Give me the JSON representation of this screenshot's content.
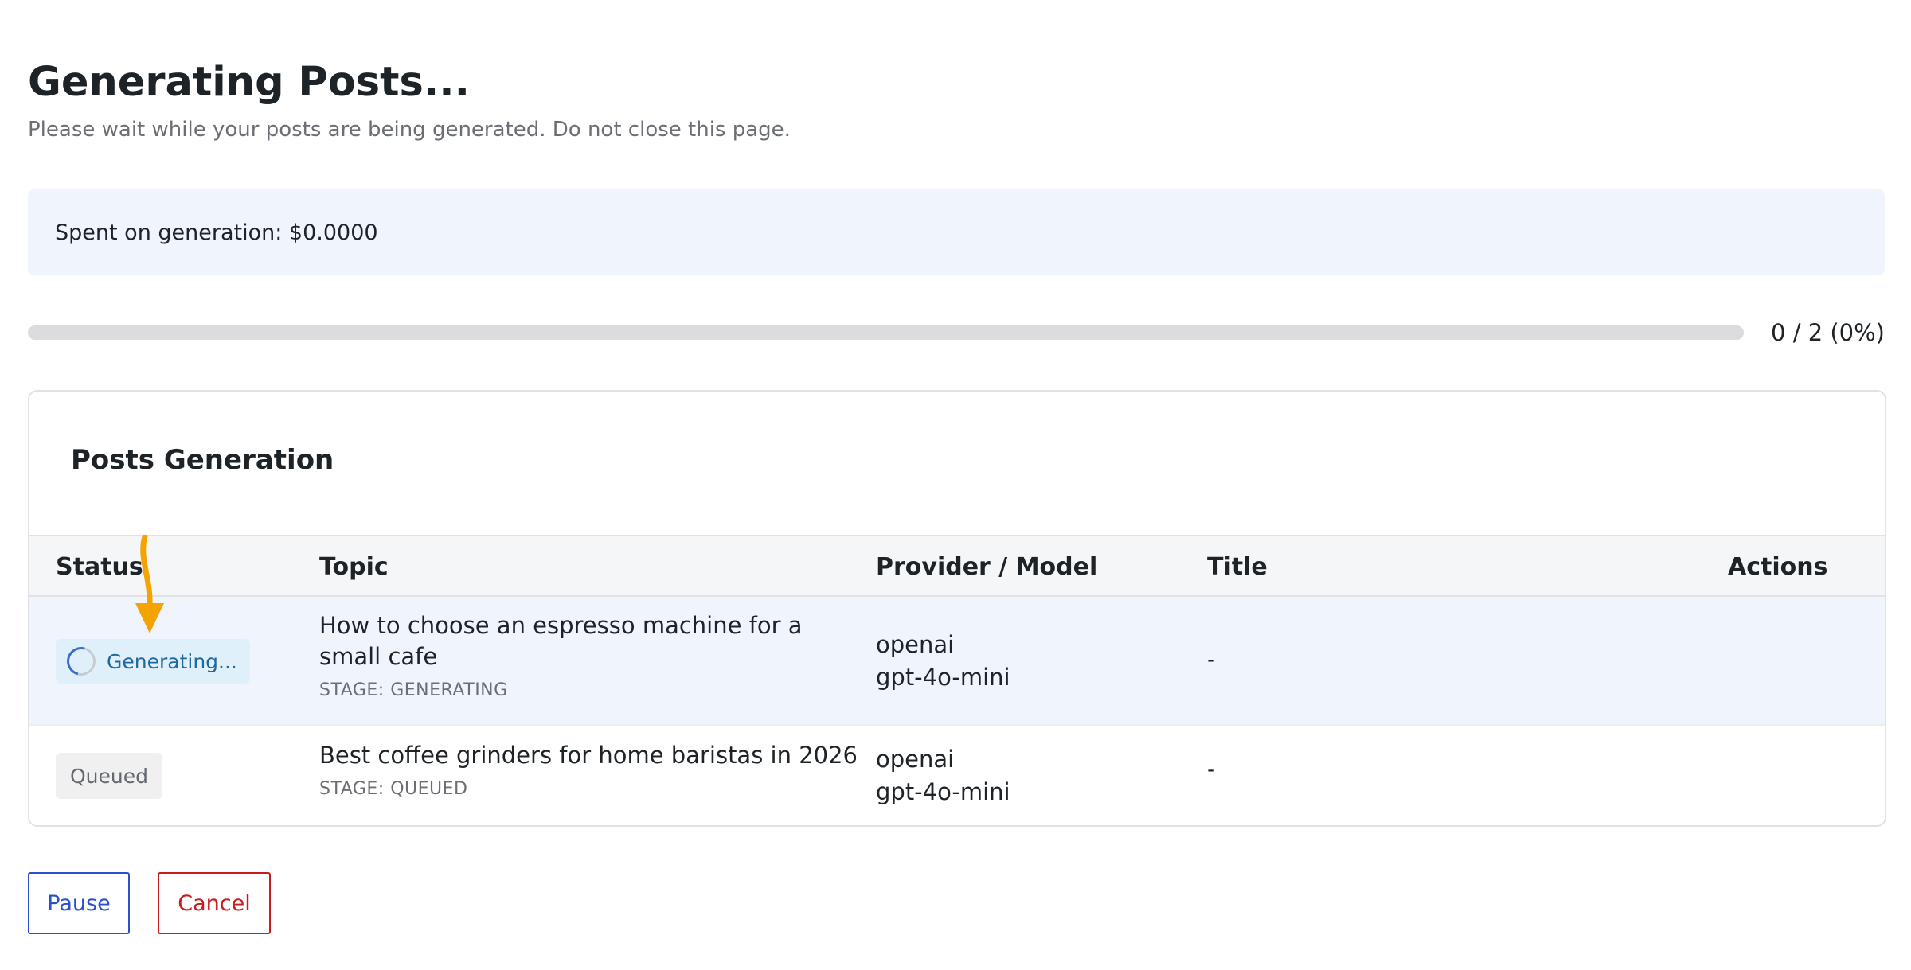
{
  "header": {
    "title": "Generating Posts...",
    "subtitle": "Please wait while your posts are being generated. Do not close this page."
  },
  "cost": {
    "text": "Spent on generation: $0.0000"
  },
  "progress": {
    "done": 0,
    "total": 2,
    "percent": 0,
    "label": "0 / 2 (0%)"
  },
  "card": {
    "title": "Posts Generation",
    "columns": {
      "status": "Status",
      "topic": "Topic",
      "provider_model": "Provider / Model",
      "title": "Title",
      "actions": "Actions"
    },
    "rows": [
      {
        "status": "Generating...",
        "topic_line1": "How to choose an espresso machine for a",
        "topic_line2": "small cafe",
        "stage": "STAGE: GENERATING",
        "provider": "openai",
        "model": "gpt-4o-mini",
        "title": "-"
      },
      {
        "status": "Queued",
        "topic_line1": "Best coffee grinders for home baristas in 2026",
        "stage": "STAGE: QUEUED",
        "provider": "openai",
        "model": "gpt-4o-mini",
        "title": "-"
      }
    ]
  },
  "buttons": {
    "pause": "Pause",
    "cancel": "Cancel"
  },
  "colors": {
    "accent": "#2a4fcf",
    "danger": "#c91c1c",
    "generating_badge": "#e0f0fa",
    "queued_badge": "#f0f0f1",
    "annotation_arrow": "#f5a300"
  },
  "icons": {
    "spinner": "loading-spinner-icon",
    "annotation": "arrow-down-icon"
  }
}
